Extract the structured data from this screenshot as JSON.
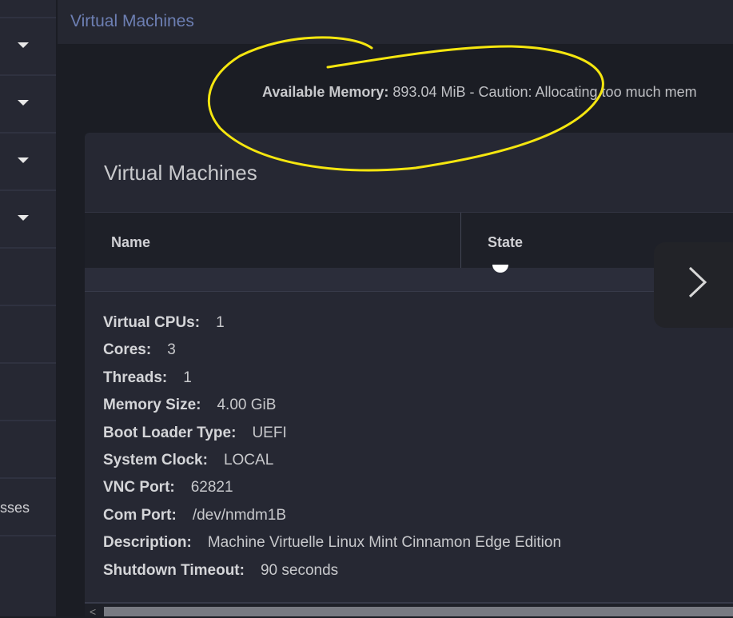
{
  "sidebar": {
    "partial_label": "sses"
  },
  "header": {
    "title": "Virtual Machines"
  },
  "memory": {
    "label": "Available Memory:",
    "text": "893.04 MiB - Caution: Allocating too much mem"
  },
  "card": {
    "title": "Virtual Machines",
    "columns": [
      "Name",
      "State"
    ],
    "details": [
      {
        "label": "Virtual CPUs:",
        "value": "1"
      },
      {
        "label": "Cores:",
        "value": "3"
      },
      {
        "label": "Threads:",
        "value": "1"
      },
      {
        "label": "Memory Size:",
        "value": "4.00 GiB"
      },
      {
        "label": "Boot Loader Type:",
        "value": "UEFI"
      },
      {
        "label": "System Clock:",
        "value": "LOCAL"
      },
      {
        "label": "VNC Port:",
        "value": "62821"
      },
      {
        "label": "Com Port:",
        "value": "/dev/nmdm1B"
      },
      {
        "label": "Description:",
        "value": "Machine Virtuelle Linux Mint Cinnamon Edge Edition"
      },
      {
        "label": "Shutdown Timeout:",
        "value": "90 seconds"
      }
    ]
  },
  "colors": {
    "annotation": "#f5e60f",
    "title_link": "#6d7fb3"
  }
}
